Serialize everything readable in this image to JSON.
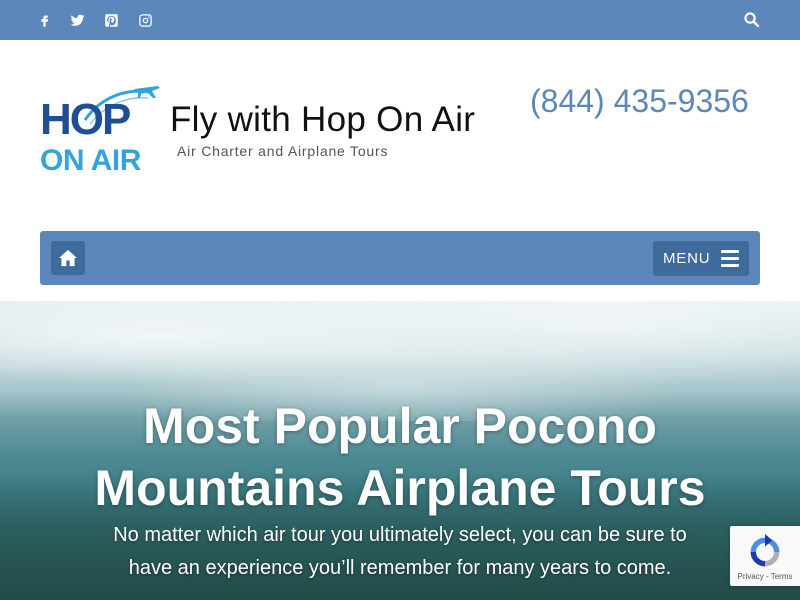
{
  "topbar": {
    "social": [
      {
        "name": "facebook"
      },
      {
        "name": "twitter"
      },
      {
        "name": "pinterest"
      },
      {
        "name": "instagram"
      }
    ],
    "search_icon": "search-icon",
    "bg_color": "#5b87bb"
  },
  "header": {
    "logo": {
      "line1": "HOP",
      "line2": "ON AIR"
    },
    "site_title": "Fly with Hop On Air",
    "tagline": "Air Charter and Airplane Tours",
    "phone": "(844) 435-9356"
  },
  "nav": {
    "home_icon": "home-icon",
    "menu_label": "MENU"
  },
  "hero": {
    "title_line1": "Most Popular Pocono",
    "title_line2": "Mountains Airplane Tours",
    "sub_line1": "No matter which air tour you ultimately select, you can be sure to",
    "sub_line2": "have an experience you’ll remember for many years to come."
  },
  "recaptcha": {
    "footer": "Privacy - Terms"
  },
  "colors": {
    "accent": "#5b87bb",
    "accent_dark": "#3f6a9c",
    "logo_navy": "#1f4f93",
    "logo_cyan": "#33a3dc"
  }
}
